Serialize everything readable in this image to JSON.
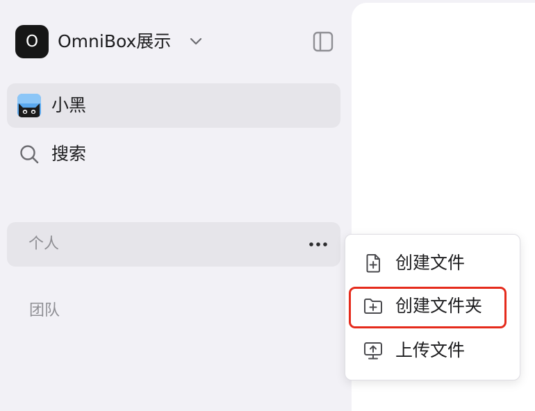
{
  "workspace": {
    "logo_letter": "O",
    "name": "OmniBox展示"
  },
  "nav": {
    "user_label": "小黑",
    "search_label": "搜索"
  },
  "sections": {
    "personal": "个人",
    "team": "团队"
  },
  "context_menu": {
    "items": [
      {
        "label": "创建文件",
        "icon": "file-plus-icon"
      },
      {
        "label": "创建文件夹",
        "icon": "folder-plus-icon",
        "highlighted": true
      },
      {
        "label": "上传文件",
        "icon": "upload-icon"
      }
    ]
  },
  "colors": {
    "sidebar_bg": "#f2f1f6",
    "active_item_bg": "#e6e5ea",
    "highlight_border": "#e52b1c",
    "muted_text": "#8e8e93"
  }
}
